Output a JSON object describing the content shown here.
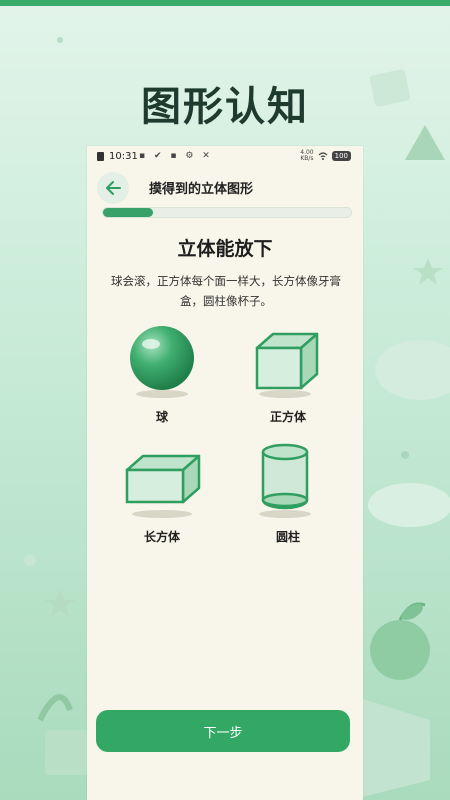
{
  "page_title": "图形认知",
  "status_bar": {
    "time": "10:31",
    "icons": "▪ ✔ ▪ ⚙ ✕",
    "net_speed_value": "4.00",
    "net_speed_unit": "KB/s",
    "battery": "100"
  },
  "nav": {
    "title": "摸得到的立体图形"
  },
  "progress": {
    "fraction": 0.2
  },
  "lesson": {
    "heading": "立体能放下",
    "description": "球会滚，正方体每个面一样大，长方体像牙膏盒，圆柱像杯子。"
  },
  "shapes": [
    {
      "label": "球",
      "icon": "sphere-icon"
    },
    {
      "label": "正方体",
      "icon": "cube-icon"
    },
    {
      "label": "长方体",
      "icon": "cuboid-icon"
    },
    {
      "label": "圆柱",
      "icon": "cylinder-icon"
    }
  ],
  "next_button": {
    "label": "下一步"
  },
  "colors": {
    "accent": "#33a865",
    "shape_fill": "#cfe9d6",
    "shape_stroke": "#2f9e60",
    "card_bg": "#f8f6ea"
  }
}
